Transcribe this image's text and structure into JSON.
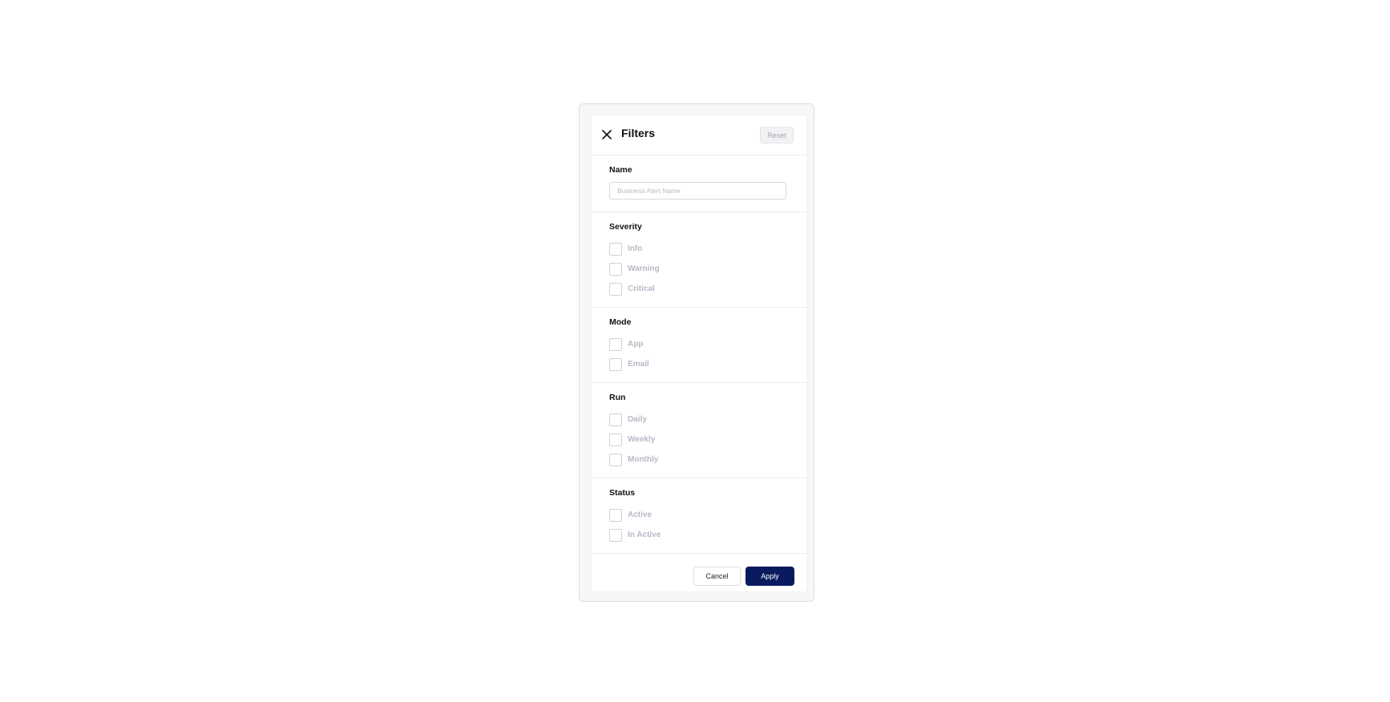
{
  "dialog": {
    "title": "Filters",
    "reset_label": "Reset",
    "close_icon": "close-icon"
  },
  "name_section": {
    "label": "Name",
    "input_value": "",
    "placeholder": "Business Alert Name"
  },
  "sections": {
    "severity": {
      "label": "Severity",
      "options": [
        "Info",
        "Warning",
        "Critical"
      ]
    },
    "mode": {
      "label": "Mode",
      "options": [
        "App",
        "Email"
      ]
    },
    "run": {
      "label": "Run",
      "options": [
        "Daily",
        "Weekly",
        "Monthly"
      ]
    },
    "status": {
      "label": "Status",
      "options": [
        "Active",
        "In Active"
      ]
    }
  },
  "footer": {
    "cancel_label": "Cancel",
    "apply_label": "Apply"
  },
  "colors": {
    "primary": "#0a1a5e",
    "option_text": "#b6bac6",
    "border": "#dcdde2"
  }
}
